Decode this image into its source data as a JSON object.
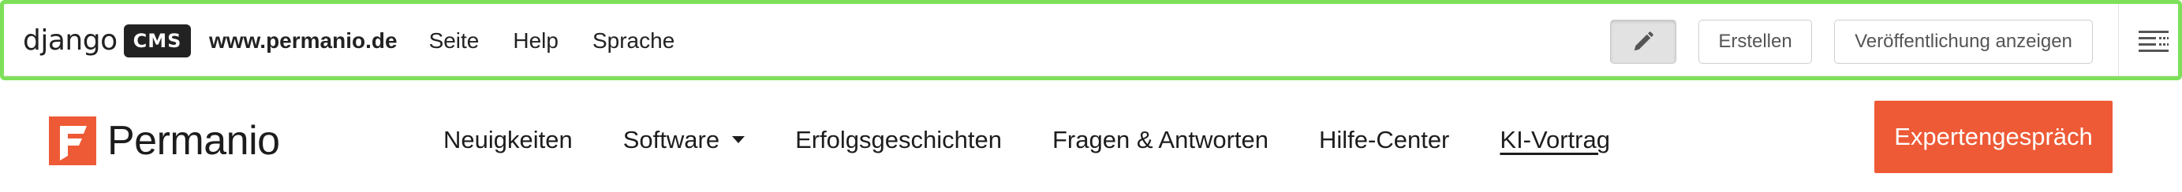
{
  "cms_toolbar": {
    "logo_word": "django",
    "logo_badge": "CMS",
    "menu": {
      "site": "www.permanio.de",
      "page": "Seite",
      "help": "Help",
      "language": "Sprache"
    },
    "edit_icon": "pencil-icon",
    "create_label": "Erstellen",
    "publish_view_label": "Veröffentlichung anzeigen",
    "structure_icon": "structure-mode-icon"
  },
  "site_header": {
    "brand_name": "Permanio",
    "brand_icon": "permanio-logo-icon",
    "nav": [
      {
        "label": "Neuigkeiten"
      },
      {
        "label": "Software",
        "has_dropdown": true
      },
      {
        "label": "Erfolgsgeschichten"
      },
      {
        "label": "Fragen & Antworten"
      },
      {
        "label": "Hilfe-Center"
      },
      {
        "label": "KI-Vortrag",
        "underlined": true
      }
    ],
    "cta_label": "Expertengespräch"
  },
  "colors": {
    "toolbar_outline": "#7ee05a",
    "cta_background": "#ee5a36",
    "brand_orange": "#ee5a36",
    "text_dark": "#1d1d1d"
  }
}
